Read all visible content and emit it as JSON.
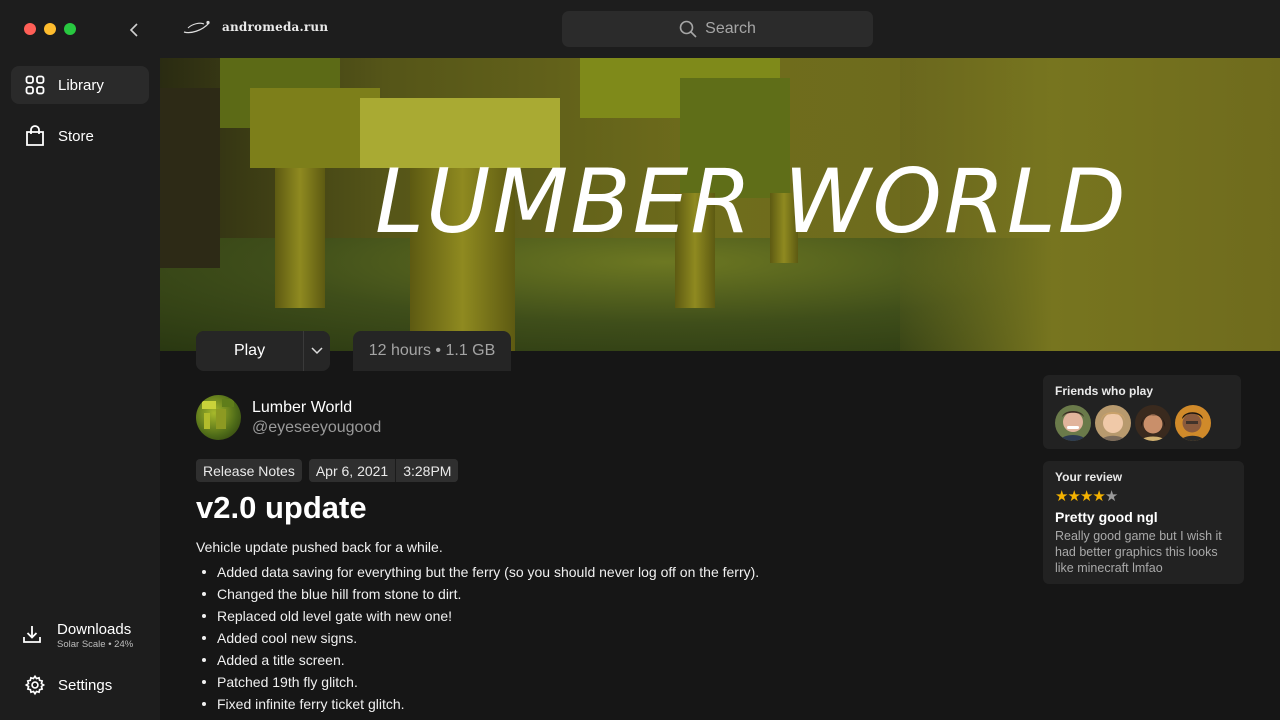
{
  "app": {
    "brand": "andromeda.run"
  },
  "sidebar": {
    "items": [
      {
        "label": "Library",
        "icon": "grid-icon",
        "active": true
      },
      {
        "label": "Store",
        "icon": "bag-icon",
        "active": false
      }
    ],
    "downloads": {
      "label": "Downloads",
      "status": "Solar Scale • 24%"
    },
    "settings": {
      "label": "Settings",
      "icon": "gear-icon"
    }
  },
  "search": {
    "placeholder": "Search"
  },
  "hero": {
    "title": "LUMBER WORLD"
  },
  "controls": {
    "play_label": "Play",
    "playtime": "12 hours • 1.1 GB"
  },
  "game": {
    "name": "Lumber World",
    "handle": "@eyeseeyougood"
  },
  "release": {
    "tag": "Release Notes",
    "date": "Apr 6, 2021",
    "time": "3:28PM",
    "title": "v2.0 update",
    "intro": "Vehicle update pushed back for a while.",
    "notes": [
      "Added data saving for everything but the ferry (so you should never log off on the ferry).",
      "Changed the blue hill from stone to dirt.",
      "Replaced old level gate with new one!",
      "Added cool new signs.",
      "Added a title screen.",
      "Patched 19th fly glitch.",
      "Fixed infinite ferry ticket glitch."
    ]
  },
  "friends": {
    "title": "Friends who play",
    "count": 4
  },
  "review": {
    "title": "Your review",
    "rating": 4,
    "max_rating": 5,
    "headline": "Pretty good ngl",
    "body": "Really good game but I wish it had better graphics this looks like minecraft lmfao"
  },
  "colors": {
    "accent_star": "#f5b301",
    "background": "#161616",
    "sidebar": "#1d1d1d"
  }
}
